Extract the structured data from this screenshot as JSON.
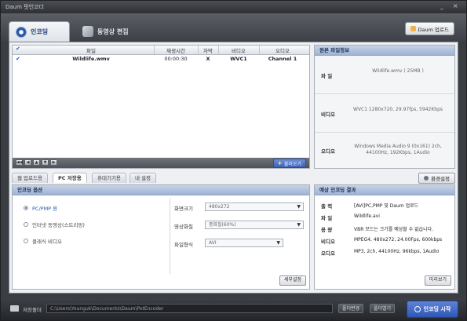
{
  "window": {
    "title": "Daum 팟인코더",
    "controls": [
      "_",
      "×"
    ]
  },
  "tabs": [
    {
      "label": "인코딩",
      "active": true,
      "icon": "disc-icon"
    },
    {
      "label": "동영상 편집",
      "active": false,
      "icon": "scissors-icon"
    }
  ],
  "daum_upload_label": "Daum 업로드",
  "file_table": {
    "columns": [
      "파일",
      "재생시간",
      "자막",
      "비디오",
      "오디오"
    ],
    "rows": [
      {
        "checked": true,
        "file": "Wildlife.wmv",
        "duration": "00:00:30",
        "subtitle": "X",
        "video": "WVC1",
        "audio": "Channel 1"
      }
    ],
    "nav_buttons": [
      "◀◀",
      "◀",
      "▲",
      "▼",
      "▶"
    ],
    "add_button": "불러오기"
  },
  "source_info": {
    "title": "원본 파일정보",
    "rows": [
      {
        "key": "파 일",
        "value": "Wildlife.wmv ( 25MB )"
      },
      {
        "key": "비디오",
        "value": "WVC1 1280x720, 29.97fps, 5942Kbps"
      },
      {
        "key": "오디오",
        "value": "Windows Media Audio 9 (0x161) 2ch, 44100Hz, 192Kbps, 1Audio"
      }
    ]
  },
  "subtabs": [
    {
      "label": "웹 업로드용",
      "active": false
    },
    {
      "label": "PC 저장용",
      "active": true
    },
    {
      "label": "휴대기기용",
      "active": false
    },
    {
      "label": "내 설정",
      "active": false
    }
  ],
  "env_settings_label": "환경설정",
  "encoding_options": {
    "title": "인코딩 옵션",
    "radios": [
      {
        "label": "PC/PMP 용",
        "selected": true
      },
      {
        "label": "인터넷 동영상(스트리밍)",
        "selected": false
      },
      {
        "label": "클래식 비디오",
        "selected": false
      }
    ],
    "fields": [
      {
        "label": "화면크기",
        "value": "480x272"
      },
      {
        "label": "영상화질",
        "value": "중화질(60%)"
      },
      {
        "label": "파일형식",
        "value": "AVI"
      }
    ],
    "detail_button": "세부설정"
  },
  "estimate": {
    "title": "예상 인코딩 결과",
    "rows": [
      {
        "key": "출 력",
        "value": "[AVI]PC,PMP 및 Daum 업로드"
      },
      {
        "key": "파 일",
        "value": "Wildlife.avi"
      },
      {
        "key": "용 량",
        "value": "VBR 모드는 크기를 예상할 수 없습니다."
      },
      {
        "key": "비디오",
        "value": "MPEG4, 480x272, 24.00Fps, 600kbps"
      },
      {
        "key": "오디오",
        "value": "MP3, 2ch, 44100Hz, 96kbps, 1Audio"
      }
    ],
    "preview_button": "미리보기"
  },
  "status": {
    "save_label": "저장폴더",
    "path": "C:\\Users\\Younguk\\Documents\\Daum\\PotEncoder",
    "change_button": "폴더변경",
    "open_button": "폴더열기",
    "start_button": "인코딩 시작"
  }
}
